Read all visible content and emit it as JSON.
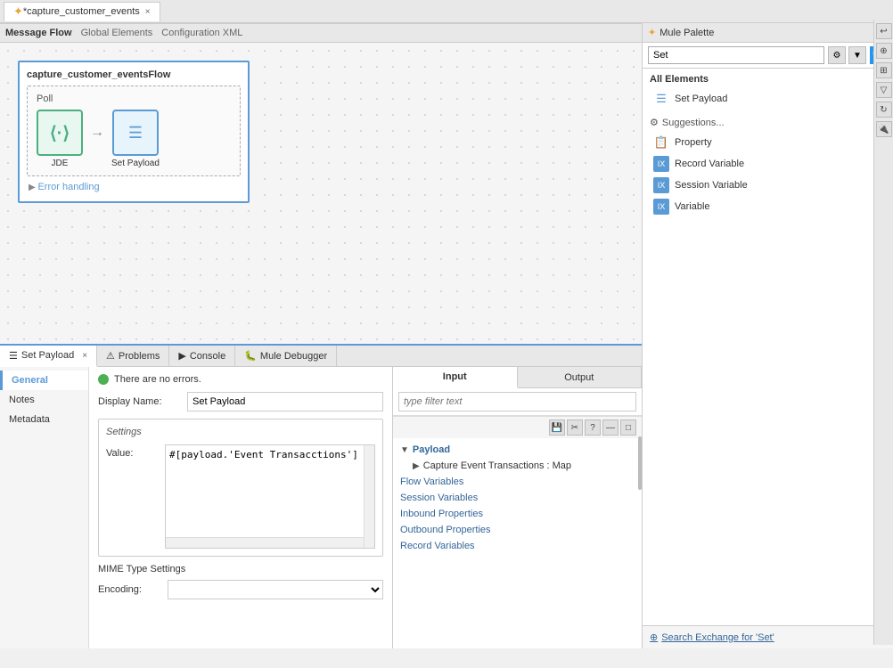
{
  "window": {
    "title": "*capture_customer_events",
    "close_x": "×"
  },
  "palette": {
    "title": "Mule Palette",
    "close_x": "×",
    "search_value": "Set",
    "search_placeholder": "Set",
    "all_elements_label": "All Elements",
    "set_payload_item": "Set Payload",
    "suggestions_label": "Suggestions...",
    "items": [
      {
        "label": "Property",
        "icon": "📋"
      },
      {
        "label": "Record Variable",
        "icon": "🔣"
      },
      {
        "label": "Session Variable",
        "icon": "🔣"
      },
      {
        "label": "Variable",
        "icon": "🔣"
      }
    ],
    "search_exchange_label": "Search Exchange for 'Set'"
  },
  "canvas": {
    "flow_title": "capture_customer_eventsFlow",
    "lane_label": "Poll",
    "nodes": [
      {
        "label": "JDE",
        "icon": "⟨-⟩",
        "type": "source"
      },
      {
        "label": "Set Payload",
        "icon": "≡",
        "type": "processor",
        "selected": true
      }
    ],
    "error_handling": "Error handling"
  },
  "sub_tabs": [
    {
      "label": "Message Flow",
      "active": true
    },
    {
      "label": "Global Elements",
      "active": false
    },
    {
      "label": "Configuration XML",
      "active": false
    }
  ],
  "bottom_tabs": [
    {
      "label": "Set Payload",
      "active": true,
      "closeable": true,
      "icon": "≡"
    },
    {
      "label": "Problems",
      "active": false,
      "icon": "⚠"
    },
    {
      "label": "Console",
      "active": false,
      "icon": "▶"
    },
    {
      "label": "Mule Debugger",
      "active": false,
      "icon": "🐛"
    }
  ],
  "props_sidebar": [
    {
      "label": "General",
      "active": true
    },
    {
      "label": "Notes",
      "active": false
    },
    {
      "label": "Metadata",
      "active": false
    }
  ],
  "properties": {
    "no_errors": "There are no errors.",
    "display_name_label": "Display Name:",
    "display_name_value": "Set Payload",
    "settings_label": "Settings",
    "value_label": "Value:",
    "value_content": "#[payload.'Event Transacctions']",
    "mime_settings_label": "MIME Type Settings",
    "encoding_label": "Encoding:"
  },
  "props_right": {
    "input_tab": "Input",
    "output_tab": "Output",
    "search_placeholder": "type filter text",
    "tree": [
      {
        "label": "Payload",
        "type": "section",
        "expanded": true,
        "indent": 0
      },
      {
        "label": "Capture Event Transactions : Map",
        "type": "child",
        "indent": 1
      },
      {
        "label": "Flow Variables",
        "type": "link",
        "indent": 0
      },
      {
        "label": "Session Variables",
        "type": "link",
        "indent": 0
      },
      {
        "label": "Inbound Properties",
        "type": "link",
        "indent": 0
      },
      {
        "label": "Outbound Properties",
        "type": "link",
        "indent": 0
      },
      {
        "label": "Record Variables",
        "type": "link",
        "indent": 0
      }
    ],
    "mini_toolbar_buttons": [
      "💾",
      "✂",
      "?"
    ]
  },
  "palette_side_icons": [
    "↩",
    "⊕",
    "⊞",
    "▽",
    "↻",
    "🔌"
  ],
  "props_right_side_icons": [
    "▲",
    "▼"
  ]
}
